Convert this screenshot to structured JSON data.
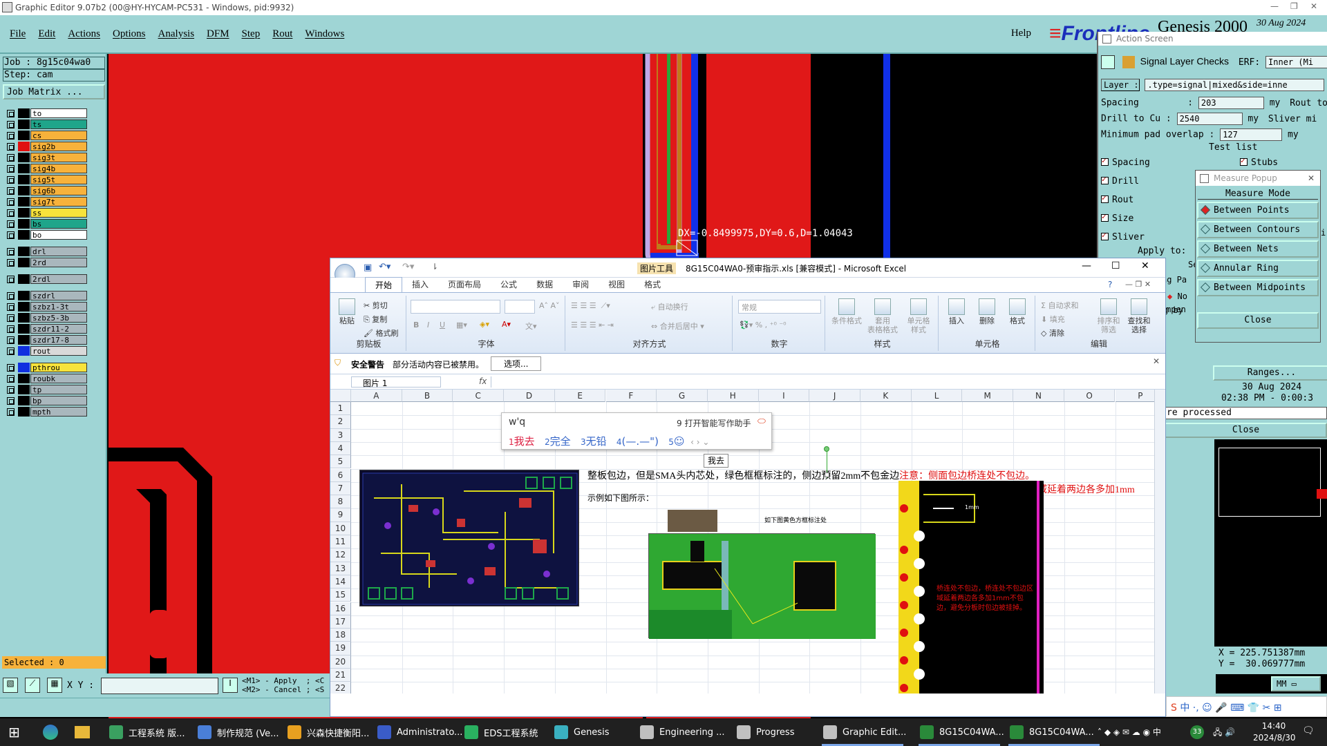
{
  "window": {
    "title": "Graphic Editor 9.07b2 (00@HY-HYCAM-PC531 - Windows, pid:9932)"
  },
  "menu": {
    "items": [
      "File",
      "Edit",
      "Actions",
      "Options",
      "Analysis",
      "DFM",
      "Step",
      "Rout",
      "Windows"
    ],
    "help": "Help"
  },
  "brand": {
    "logo": "Frontline",
    "product": "Genesis 2000",
    "date": "30 Aug 2024"
  },
  "left": {
    "job": "Job : 8g15c04wa0",
    "step": "Step: cam",
    "job_matrix": "Job Matrix ...",
    "layers": [
      {
        "name": "to",
        "swatch": "#000000",
        "bg": "#ffffff"
      },
      {
        "name": "ts",
        "swatch": "#000000",
        "bg": "#1fa58a"
      },
      {
        "name": "cs",
        "swatch": "#000000",
        "bg": "#f7b23b"
      },
      {
        "name": "sig2b",
        "swatch": "#e01010",
        "bg": "#f7b23b"
      },
      {
        "name": "sig3t",
        "swatch": "#000000",
        "bg": "#f7b23b"
      },
      {
        "name": "sig4b",
        "swatch": "#000000",
        "bg": "#f7b23b"
      },
      {
        "name": "sig5t",
        "swatch": "#000000",
        "bg": "#f7b23b"
      },
      {
        "name": "sig6b",
        "swatch": "#000000",
        "bg": "#f7b23b"
      },
      {
        "name": "sig7t",
        "swatch": "#000000",
        "bg": "#f7b23b"
      },
      {
        "name": "ss",
        "swatch": "#000000",
        "bg": "#f7e33b"
      },
      {
        "name": "bs",
        "swatch": "#000000",
        "bg": "#1fa58a"
      },
      {
        "name": "bo",
        "swatch": "#000000",
        "bg": "#ffffff"
      },
      {
        "gap": true
      },
      {
        "name": "drl",
        "swatch": "#000000",
        "bg": "#a9b7bd"
      },
      {
        "name": "2rd",
        "swatch": "#000000",
        "bg": "#a9b7bd"
      },
      {
        "gap": true
      },
      {
        "name": "2rdl",
        "swatch": "#000000",
        "bg": "#a9b7bd"
      },
      {
        "gap": true
      },
      {
        "name": "szdrl",
        "swatch": "#000000",
        "bg": "#a9b7bd"
      },
      {
        "name": "szbz1-3t",
        "swatch": "#000000",
        "bg": "#a9b7bd"
      },
      {
        "name": "szbz5-3b",
        "swatch": "#000000",
        "bg": "#a9b7bd"
      },
      {
        "name": "szdr11-2",
        "swatch": "#000000",
        "bg": "#a9b7bd"
      },
      {
        "name": "szdr17-8",
        "swatch": "#000000",
        "bg": "#a9b7bd"
      },
      {
        "name": "rout",
        "swatch": "#1030e0",
        "bg": "#d9d9d9"
      },
      {
        "gap": true
      },
      {
        "name": "pthrou",
        "swatch": "#1030e0",
        "bg": "#f7e33b"
      },
      {
        "name": "roubk",
        "swatch": "#000000",
        "bg": "#a9b7bd"
      },
      {
        "name": "tp",
        "swatch": "#000000",
        "bg": "#a9b7bd"
      },
      {
        "name": "bp",
        "swatch": "#000000",
        "bg": "#a9b7bd"
      },
      {
        "name": "mpth",
        "swatch": "#000000",
        "bg": "#a9b7bd"
      }
    ],
    "selected": "Selected : 0"
  },
  "canvas": {
    "measure_readout": "DX=-0.8499975,DY=0.6,D=1.04043"
  },
  "bottom": {
    "xy_label": "X Y :",
    "xy_value": "",
    "m1": "<M1> - Apply  ; <C",
    "m2": "<M2> - Cancel ; <S"
  },
  "action": {
    "title": "Action Screen",
    "check_name": "Signal Layer Checks",
    "erf_label": "ERF:",
    "erf_value": "Inner (Mi",
    "layer_label": "Layer :",
    "layer_value": ".type=signal|mixed&side=inne",
    "spacing_label": "Spacing         :",
    "spacing_value": "203",
    "spacing_unit": "my",
    "spacing_right": "Rout to C",
    "drill_label": "Drill to Cu :",
    "drill_value": "2540",
    "drill_unit": "my",
    "drill_right": "Sliver mi",
    "pad_label": "Minimum pad overlap :",
    "pad_value": "127",
    "pad_unit": "my",
    "test_list": "Test list",
    "tests": [
      "Spacing",
      "Drill",
      "Rout",
      "Size",
      "Sliver"
    ],
    "test_stubs": "Stubs",
    "apply_to": "Apply to:",
    "frag_se": "Se",
    "frag_ng": "ng Pa",
    "frag_no": "No",
    "frag_by": "g by",
    "frag_pen": "mpen",
    "frag_i": "i",
    "frag_l": "l"
  },
  "measure": {
    "title": "Measure Popup",
    "mode": "Measure Mode",
    "options": [
      "Between Points",
      "Between Contours",
      "Between Nets",
      "Annular Ring",
      "Between Midpoints"
    ],
    "selected": "Between Points",
    "close": "Close"
  },
  "rlower": {
    "ranges": "Ranges...",
    "date": "30 Aug 2024",
    "time": "02:38 PM - 0:00:3",
    "processed": "re processed",
    "close": "Close",
    "x": "X = 225.751387mm",
    "y": "Y =  30.069777mm",
    "unit": "MM"
  },
  "excel": {
    "context_tab": "图片工具",
    "title": "8G15C04WA0-预审指示.xls  [兼容模式] - Microsoft Excel",
    "tabs": [
      "开始",
      "插入",
      "页面布局",
      "公式",
      "数据",
      "审阅",
      "视图",
      "格式"
    ],
    "active_tab": "开始",
    "clipboard": {
      "paste": "粘贴",
      "cut": "剪切",
      "copy": "复制",
      "format_painter": "格式刷",
      "group": "剪贴板"
    },
    "font": {
      "bold": "B",
      "italic": "I",
      "underline": "U",
      "group": "字体"
    },
    "align": {
      "wrap": "自动换行",
      "merge": "合并后居中",
      "group": "对齐方式"
    },
    "number": {
      "format": "常规",
      "group": "数字"
    },
    "styles": {
      "cond": "条件格式",
      "table": "套用\n表格格式",
      "cell": "单元格\n样式",
      "group": "样式"
    },
    "cells": {
      "insert": "插入",
      "delete": "删除",
      "format": "格式",
      "group": "单元格"
    },
    "editing": {
      "autosum": "自动求和",
      "fill": "填充",
      "clear": "清除",
      "sort": "排序和\n筛选",
      "find": "查找和\n选择",
      "group": "编辑"
    },
    "security": {
      "label": "安全警告",
      "message": "部分活动内容已被禁用。",
      "options": "选项..."
    },
    "namebox": "图片 1",
    "fx": "fx",
    "columns": [
      "A",
      "B",
      "C",
      "D",
      "E",
      "F",
      "G",
      "H",
      "I",
      "J",
      "K",
      "L",
      "M",
      "N",
      "O",
      "P"
    ],
    "rows": [
      "1",
      "2",
      "3",
      "4",
      "5",
      "6",
      "7",
      "8",
      "9",
      "10",
      "11",
      "12",
      "13",
      "14",
      "15",
      "16",
      "17",
      "18",
      "19",
      "20",
      "21",
      "22"
    ],
    "note_main": "整板包边，但是SMA头内芯处，绿色框框标注的，侧边预留2mm不包金边",
    "note_attn": "注意：侧面包边桥连处不包边。",
    "note_line2": "桥连处不包边区域延着两边各多加1mm",
    "example": "示例如下图所示：",
    "img_caption": "如下图黄色方框标注处",
    "img_annot": "桥连处不包边，桥连处不包边区域延着两边各多加1mm不包边，避免分板时包边被挂掉。",
    "img_dim": "1mm"
  },
  "ime": {
    "input": "w'q",
    "assist": "9 打开智能写作助手",
    "candidates": [
      {
        "num": "1",
        "text": "我去"
      },
      {
        "num": "2",
        "text": "完全"
      },
      {
        "num": "3",
        "text": "无铅"
      },
      {
        "num": "4",
        "text": "(—.—\")"
      },
      {
        "num": "5",
        "text": ""
      }
    ],
    "tooltip": "我去"
  },
  "taskbar": {
    "items": [
      "工程系统  版...",
      "制作规范 (Ve...",
      "兴森快捷衡阳...",
      "Administrato...",
      "EDS工程系统",
      "Genesis",
      "Engineering ...",
      "Progress",
      "Graphic Edit...",
      "8G15C04WA...",
      "8G15C04WA..."
    ],
    "time": "14:40",
    "date": "2024/8/30",
    "lang": "中",
    "notif": "33"
  }
}
